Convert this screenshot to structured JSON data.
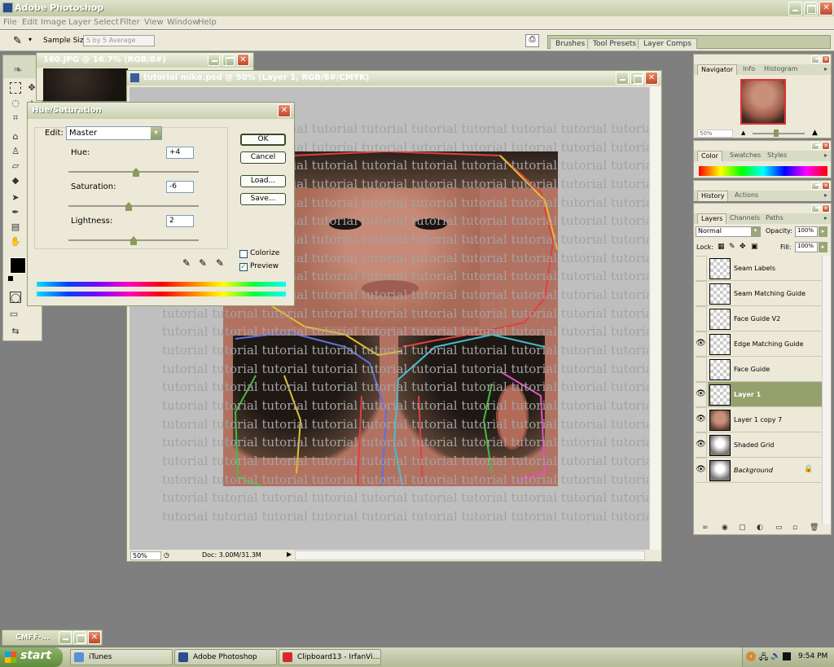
{
  "app": {
    "title": "Adobe Photoshop"
  },
  "menu": [
    "File",
    "Edit",
    "Image",
    "Layer",
    "Select",
    "Filter",
    "View",
    "Window",
    "Help"
  ],
  "options": {
    "sample_size_label": "Sample Size:",
    "sample_size_value": "5 by 5 Average"
  },
  "palette_well": {
    "tabs": [
      "Brushes",
      "Tool Presets",
      "Layer Comps"
    ]
  },
  "doc_back": {
    "title": "160.JPG @ 16.7% (RGB/8#)"
  },
  "doc_main": {
    "title": "tutorial mike.psd @ 50% (Layer 1, RGB/8#/CMYK)",
    "status_zoom": "50%",
    "status_doc": "Doc: 3.00M/31.3M",
    "watermark_line": "tutorial tutorial tutorial tutorial tutorial tutorial tutorial tutorial tutorial tutorial"
  },
  "hue_sat": {
    "title": "Hue/Saturation",
    "edit_label": "Edit:",
    "edit_value": "Master",
    "hue_label": "Hue:",
    "hue_value": "+4",
    "saturation_label": "Saturation:",
    "saturation_value": "-6",
    "lightness_label": "Lightness:",
    "lightness_value": "2",
    "ok": "OK",
    "cancel": "Cancel",
    "load": "Load...",
    "save": "Save...",
    "colorize": "Colorize",
    "preview": "Preview"
  },
  "navigator": {
    "tabs": [
      "Navigator",
      "Info",
      "Histogram"
    ],
    "zoom": "50%"
  },
  "color_panel": {
    "tabs": [
      "Color",
      "Swatches",
      "Styles"
    ]
  },
  "history_panel": {
    "tabs": [
      "History",
      "Actions"
    ]
  },
  "layers_panel": {
    "tabs": [
      "Layers",
      "Channels",
      "Paths"
    ],
    "blend_mode": "Normal",
    "opacity_label": "Opacity:",
    "opacity_value": "100%",
    "lock_label": "Lock:",
    "fill_label": "Fill:",
    "fill_value": "100%",
    "layers": [
      {
        "name": "Seam Labels",
        "visible": false
      },
      {
        "name": "Seam Matching Guide",
        "visible": false
      },
      {
        "name": "Face Guide V2",
        "visible": false
      },
      {
        "name": "Edge Matching Guide",
        "visible": true
      },
      {
        "name": "Face Guide",
        "visible": false
      },
      {
        "name": "Layer 1",
        "visible": true,
        "selected": true
      },
      {
        "name": "Layer 1 copy 7",
        "visible": true
      },
      {
        "name": "Shaded Grid",
        "visible": true
      },
      {
        "name": "Background",
        "visible": true,
        "locked": true
      }
    ]
  },
  "minimized_window": {
    "title": "CMFF-..."
  },
  "taskbar": {
    "start": "start",
    "tasks": [
      "iTunes",
      "Adobe Photoshop",
      "Clipboard13 - IrfanVi..."
    ],
    "clock": "9:54 PM"
  }
}
